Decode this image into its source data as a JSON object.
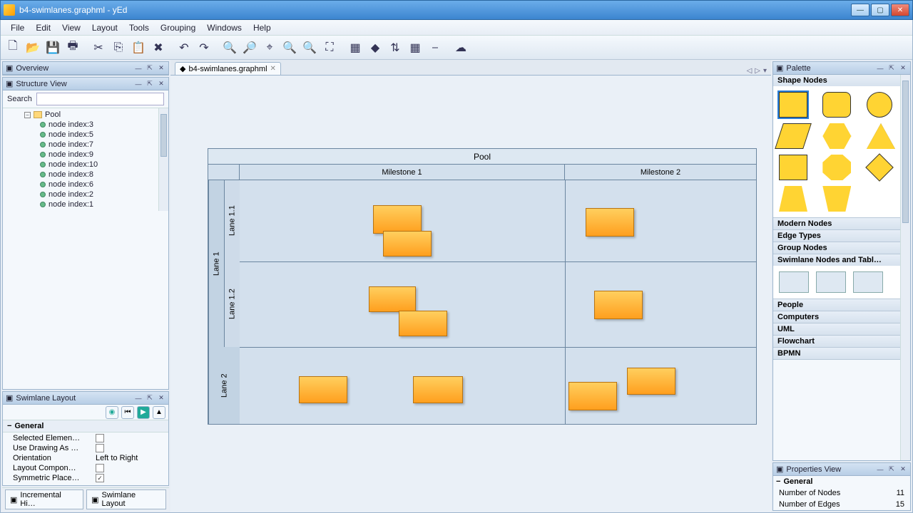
{
  "window": {
    "title": "b4-swimlanes.graphml - yEd"
  },
  "menu": {
    "items": [
      "File",
      "Edit",
      "View",
      "Layout",
      "Tools",
      "Grouping",
      "Windows",
      "Help"
    ]
  },
  "docTab": {
    "name": "b4-swimlanes.graphml"
  },
  "overview": {
    "title": "Overview"
  },
  "structure": {
    "title": "Structure View",
    "searchLabel": "Search",
    "root": "Pool",
    "nodes": [
      "node index:3",
      "node index:5",
      "node index:7",
      "node index:9",
      "node index:10",
      "node index:8",
      "node index:6",
      "node index:2",
      "node index:1"
    ]
  },
  "swimlaneLayout": {
    "title": "Swimlane Layout",
    "group": "General",
    "rows": {
      "selectedElements": "Selected Elemen…",
      "useDrawing": "Use Drawing As …",
      "orientation": "Orientation",
      "orientationVal": "Left to Right",
      "layoutComp": "Layout Compon…",
      "symmetric": "Symmetric Place…"
    },
    "tabs": {
      "incremental": "Incremental Hi…",
      "swimlane": "Swimlane Layout"
    }
  },
  "canvas": {
    "poolTitle": "Pool",
    "cols": [
      "Milestone 1",
      "Milestone 2"
    ],
    "rows": {
      "lane1": "Lane 1",
      "lane11": "Lane 1.1",
      "lane12": "Lane 1.2",
      "lane2": "Lane 2"
    }
  },
  "palette": {
    "title": "Palette",
    "sections": {
      "shapeNodes": "Shape Nodes",
      "modernNodes": "Modern Nodes",
      "edgeTypes": "Edge Types",
      "groupNodes": "Group Nodes",
      "swimlane": "Swimlane Nodes and Tabl…",
      "people": "People",
      "computers": "Computers",
      "uml": "UML",
      "flowchart": "Flowchart",
      "bpmn": "BPMN"
    }
  },
  "properties": {
    "title": "Properties View",
    "group": "General",
    "numNodesLabel": "Number of Nodes",
    "numNodes": "11",
    "numEdgesLabel": "Number of Edges",
    "numEdges": "15"
  }
}
